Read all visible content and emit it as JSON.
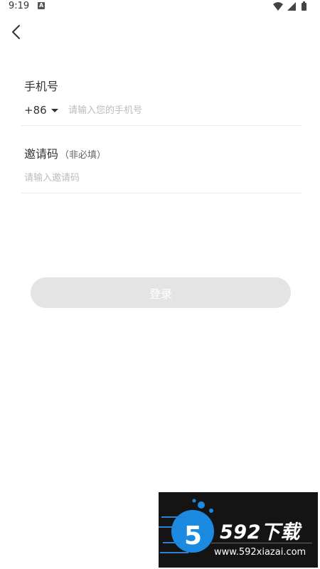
{
  "status_bar": {
    "time": "9:19"
  },
  "form": {
    "phone_label": "手机号",
    "country_code": "+86",
    "phone_placeholder": "请输入您的手机号",
    "invite_label": "邀请码",
    "invite_note": "（非必填）",
    "invite_placeholder": "请输入邀请码"
  },
  "login_button": {
    "label": "登录",
    "bg_color": "#e4e4e4"
  },
  "watermark": {
    "logo_text": "592下载",
    "url": "www.592xiazai.com"
  }
}
